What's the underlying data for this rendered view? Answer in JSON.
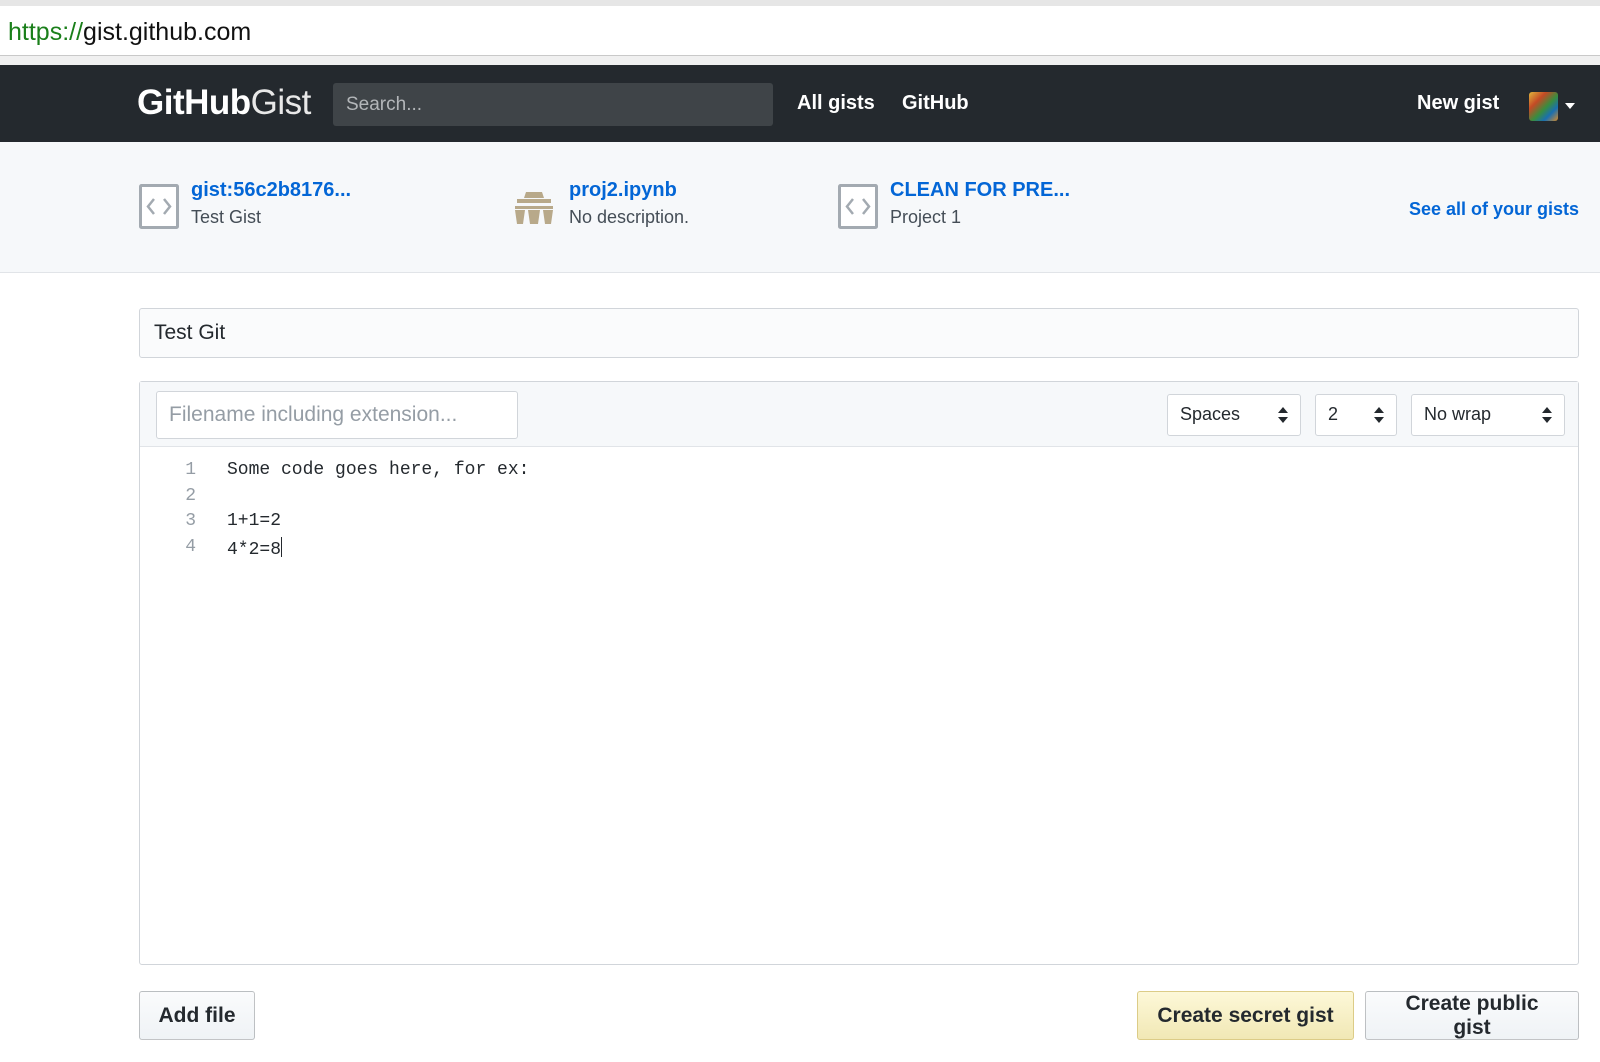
{
  "browser": {
    "url_scheme": "https://",
    "url_host": "gist.github.com"
  },
  "header": {
    "logo_bold": "GitHub",
    "logo_light": "Gist",
    "search_placeholder": "Search...",
    "nav": {
      "all_gists": "All gists",
      "github": "GitHub",
      "new_gist": "New gist"
    }
  },
  "recent_gists": {
    "items": [
      {
        "title": "gist:56c2b8176...",
        "description": "Test Gist",
        "icon": "code-icon"
      },
      {
        "title": "proj2.ipynb",
        "description": "No description.",
        "icon": "secret-icon"
      },
      {
        "title": "CLEAN FOR PRE...",
        "description": "Project 1",
        "icon": "code-icon"
      }
    ],
    "see_all": "See all of your gists"
  },
  "editor": {
    "description_value": "Test Git",
    "filename_placeholder": "Filename including extension...",
    "indent_mode": "Spaces",
    "indent_size": "2",
    "wrap_mode": "No wrap",
    "lines": [
      {
        "number": "1",
        "text": "Some code goes here, for ex:"
      },
      {
        "number": "2",
        "text": ""
      },
      {
        "number": "3",
        "text": "1+1=2"
      },
      {
        "number": "4",
        "text": "4*2=8"
      }
    ]
  },
  "actions": {
    "add_file": "Add file",
    "create_secret": "Create secret gist",
    "create_public": "Create public gist"
  },
  "colors": {
    "header_bg": "#24292e",
    "link_blue": "#0366d6",
    "secret_button_bg": "#f1e8b5",
    "url_scheme_green": "#1a7f1a"
  }
}
